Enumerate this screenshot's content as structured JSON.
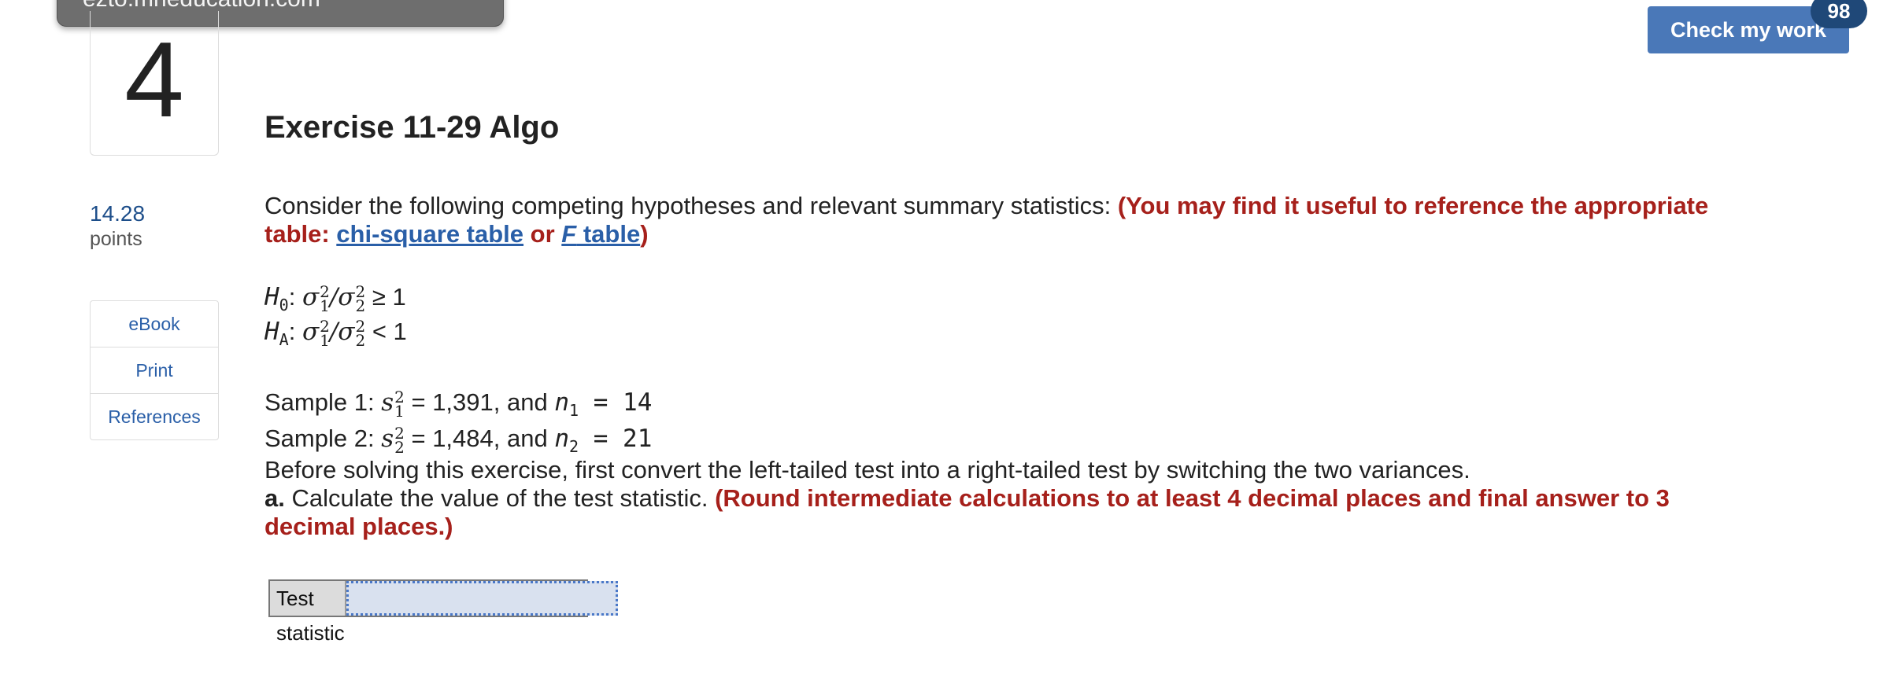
{
  "url_bubble": "ezto.mheducation.com",
  "question_number": "4",
  "title": "Exercise 11-29 Algo",
  "points": {
    "value": "14.28",
    "label": "points"
  },
  "side_links": [
    "eBook",
    "Print",
    "References"
  ],
  "check_button": "Check my work",
  "badge_count": "98",
  "intro": {
    "text": "Consider the following competing hypotheses and relevant summary statistics: ",
    "ref_prefix": "(You may find it useful to reference the appropriate table: ",
    "chi_link": "chi-square table",
    "or": " or ",
    "f_link_italic": "F",
    "f_link_rest": " table",
    "ref_suffix": ")"
  },
  "hypotheses": {
    "h0_label": "H0",
    "h0_sign": "≥ 1",
    "ha_label": "HA",
    "ha_sign": "< 1"
  },
  "samples": {
    "s1_prefix": "Sample 1: ",
    "s1_value": " = 1,391, and ",
    "s1_n": "n1",
    "s1_n_value": " = 14",
    "s2_prefix": "Sample 2: ",
    "s2_value": " = 1,484, and ",
    "s2_n": "n2",
    "s2_n_value": " = 21"
  },
  "instruction": "Before solving this exercise, first convert the left-tailed test into a right-tailed test by switching the two variances.",
  "part_a": {
    "label": "a.",
    "text": " Calculate the value of the test statistic. ",
    "note": "(Round intermediate calculations to at least 4 decimal places and final answer to 3 decimal places.)"
  },
  "answer": {
    "label": "Test statistic",
    "value": ""
  },
  "colors": {
    "accent": "#4a78b8",
    "badge": "#1f4878",
    "alert": "#a6201b",
    "link": "#2a5fa8"
  }
}
